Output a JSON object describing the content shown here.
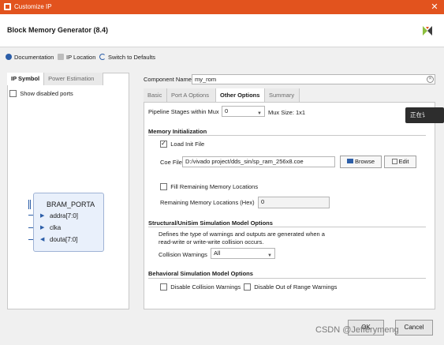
{
  "window": {
    "title": "Customize IP"
  },
  "header": {
    "title": "Block Memory Generator (8.4)"
  },
  "toolbar": {
    "documentation": "Documentation",
    "ip_location": "IP Location",
    "switch_defaults": "Switch to Defaults"
  },
  "left": {
    "tabs": [
      "IP Symbol",
      "Power Estimation"
    ],
    "show_disabled_ports": "Show disabled ports",
    "block": {
      "title": "BRAM_PORTA",
      "pins": [
        "addra[7:0]",
        "clka",
        "douta[7:0]"
      ]
    }
  },
  "right": {
    "component_name_label": "Component Name",
    "component_name_value": "my_rom",
    "tabs": [
      "Basic",
      "Port A Options",
      "Other Options",
      "Summary"
    ],
    "pipeline_label": "Pipeline Stages within Mux",
    "pipeline_value": "0",
    "mux_size": "Mux Size: 1x1",
    "mem_init": {
      "title": "Memory Initialization",
      "load_init_file": "Load Init File",
      "coe_file_label": "Coe File",
      "coe_file_value": "D:/vivado project/dds_sin/sp_ram_256x8.coe",
      "browse": "Browse",
      "edit": "Edit",
      "fill_remaining": "Fill Remaining Memory Locations",
      "remaining_label": "Remaining Memory Locations (Hex)",
      "remaining_value": "0"
    },
    "structural": {
      "title": "Structural/UniSim Simulation Model Options",
      "desc": "Defines the type of warnings and outputs are generated when a read-write or write-write collision occurs.",
      "collision_label": "Collision Warnings",
      "collision_value": "All"
    },
    "behavioral": {
      "title": "Behavioral Simulation Model Options",
      "disable_collision": "Disable Collision Warnings",
      "disable_out_of_range": "Disable Out of Range Warnings"
    }
  },
  "popup": {
    "text": "正在讠"
  },
  "footer": {
    "ok": "OK",
    "cancel": "Cancel"
  },
  "watermark": "CSDN @Jefferymeng"
}
